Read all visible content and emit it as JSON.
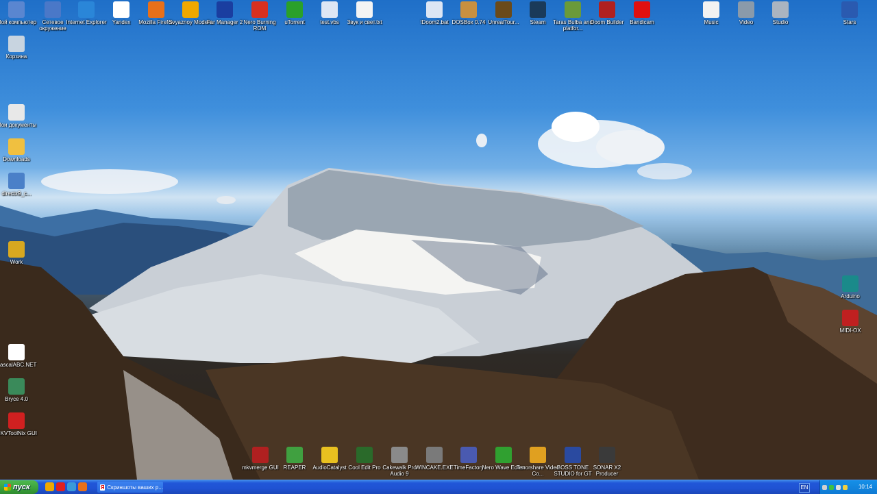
{
  "desktop_icons": [
    {
      "label": "Мой компьютер",
      "icon": "computer-icon",
      "color": "#5a86d0"
    },
    {
      "label": "Сетевое окружение",
      "icon": "network-icon",
      "color": "#4a78c8"
    },
    {
      "label": "Internet Explorer",
      "icon": "ie-icon",
      "color": "#2a86d8"
    },
    {
      "label": "Yandex",
      "icon": "yandex-icon",
      "color": "#ffffff"
    },
    {
      "label": "Mozilla Firefox",
      "icon": "firefox-icon",
      "color": "#e8701a"
    },
    {
      "label": "Svyaznoy Modem",
      "icon": "modem-icon",
      "color": "#f0a800"
    },
    {
      "label": "Far Manager 2",
      "icon": "far-icon",
      "color": "#1a3ea0"
    },
    {
      "label": "Nero Burning ROM",
      "icon": "nero-icon",
      "color": "#d83020"
    },
    {
      "label": "uTorrent",
      "icon": "utorrent-icon",
      "color": "#2aa02a"
    },
    {
      "label": "test.vbs",
      "icon": "script-icon",
      "color": "#dde6f4"
    },
    {
      "label": "Звук и свет.txt",
      "icon": "text-file-icon",
      "color": "#f4f4f4"
    },
    {
      "label": "!Doom2.bat",
      "icon": "batch-file-icon",
      "color": "#dde6f4"
    },
    {
      "label": "DOSBox 0.74",
      "icon": "dosbox-icon",
      "color": "#c89040"
    },
    {
      "label": "UnrealTour...",
      "icon": "unreal-icon",
      "color": "#6a4a1a"
    },
    {
      "label": "Steam",
      "icon": "steam-icon",
      "color": "#1a3a5a"
    },
    {
      "label": "Taras Bulba and platfor...",
      "icon": "taras-icon",
      "color": "#6a9a3a"
    },
    {
      "label": "Doom Builder",
      "icon": "doom-builder-icon",
      "color": "#b02020"
    },
    {
      "label": "Bandicam",
      "icon": "bandicam-icon",
      "color": "#e01010"
    },
    {
      "label": "Music",
      "icon": "music-file-icon",
      "color": "#f2f2f2"
    },
    {
      "label": "Video",
      "icon": "video-folder-icon",
      "color": "#8a9aaa"
    },
    {
      "label": "Studio",
      "icon": "studio-folder-icon",
      "color": "#aab4c0"
    },
    {
      "label": "Stars",
      "icon": "stars-icon",
      "color": "#2a5ab0"
    },
    {
      "label": "Корзина",
      "icon": "recycle-bin-icon",
      "color": "#c8d4e0"
    },
    {
      "label": "Мои документы",
      "icon": "my-documents-icon",
      "color": "#e8e8e8"
    },
    {
      "label": "Downloads",
      "icon": "folder-icon",
      "color": "#f0c040"
    },
    {
      "label": "directx9_c...",
      "icon": "installer-icon",
      "color": "#4a80c8"
    },
    {
      "label": "Work",
      "icon": "key-icon",
      "color": "#d8a820"
    },
    {
      "label": "PascalABC.NET",
      "icon": "pascal-icon",
      "color": "#ffffff"
    },
    {
      "label": "Bryce 4.0",
      "icon": "bryce-icon",
      "color": "#3a8a5a"
    },
    {
      "label": "MKVToolNix GUI",
      "icon": "mkvtoolnix-icon",
      "color": "#d02020"
    },
    {
      "label": "Arduino",
      "icon": "arduino-icon",
      "color": "#1a8a8a"
    },
    {
      "label": "MIDI-OX",
      "icon": "midiox-icon",
      "color": "#c02020"
    },
    {
      "label": "mkvmerge GUI",
      "icon": "mkvmerge-icon",
      "color": "#b02020"
    },
    {
      "label": "REAPER",
      "icon": "reaper-icon",
      "color": "#40a040"
    },
    {
      "label": "AudioCatalyst",
      "icon": "audiocatalyst-icon",
      "color": "#e8c020"
    },
    {
      "label": "Cool Edit Pro",
      "icon": "cooledit-icon",
      "color": "#2a6a2a"
    },
    {
      "label": "Cakewalk Pro Audio 9",
      "icon": "cakewalk-icon",
      "color": "#8a8a8a"
    },
    {
      "label": "WINCAKE.EXE",
      "icon": "wincake-icon",
      "color": "#7a7a7a"
    },
    {
      "label": "TimeFactory",
      "icon": "timefactory-icon",
      "color": "#4a5ab0"
    },
    {
      "label": "Nero Wave Editor",
      "icon": "nero-wave-icon",
      "color": "#30a030"
    },
    {
      "label": "Tenorshare Video Co...",
      "icon": "tenorshare-icon",
      "color": "#e0a020"
    },
    {
      "label": "BOSS TONE STUDIO for GT",
      "icon": "boss-icon",
      "color": "#2a4aa0"
    },
    {
      "label": "SONAR X2 Producer",
      "icon": "sonar-icon",
      "color": "#3a3a3a"
    }
  ],
  "taskbar": {
    "start_label": "пуск",
    "quick_launch": [
      {
        "icon": "modem-icon",
        "color": "#f0a800"
      },
      {
        "icon": "yandex-icon",
        "color": "#e02020"
      },
      {
        "icon": "ie-icon",
        "color": "#3a9ad8"
      },
      {
        "icon": "firefox-icon",
        "color": "#e8701a"
      }
    ],
    "task_button": {
      "label": "Скриншоты ваших р...",
      "icon": "yandex-icon"
    },
    "language": "EN",
    "clock": "10:14"
  }
}
